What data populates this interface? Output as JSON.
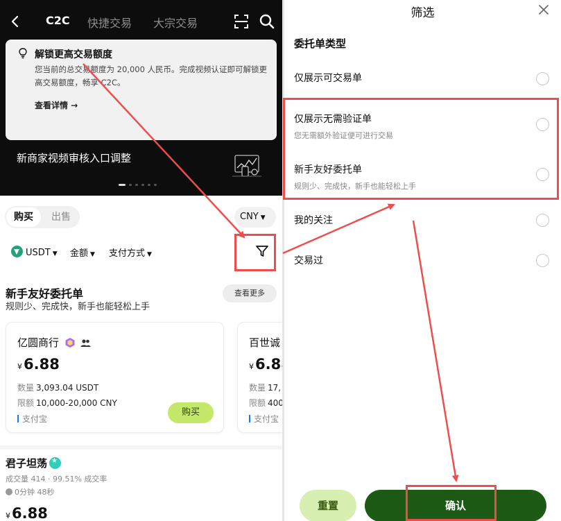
{
  "left": {
    "nav": {
      "tabs": [
        "C2C",
        "快捷交易",
        "大宗交易"
      ],
      "icons": [
        "back-icon",
        "scan-icon",
        "search-icon"
      ]
    },
    "promo": {
      "title": "解锁更高交易额度",
      "body": "您当前的总交易额度为 20,000 人民币。完成视频认证即可解锁更高交易额度，畅享 C2C。",
      "link": "查看详情 →"
    },
    "banner": {
      "text": "新商家视频审核入口调整"
    },
    "segment": {
      "buy": "购买",
      "sell": "出售"
    },
    "currency": "CNY",
    "filters": {
      "coin": "USDT",
      "amount": "金额",
      "payment": "支付方式"
    },
    "section": {
      "title": "新手友好委托单",
      "subtitle": "规则少、完成快，新手也能轻松上手",
      "see_more": "查看更多"
    },
    "cards": [
      {
        "merchant": "亿圆商行",
        "currency_symbol": "¥",
        "price": "6.88",
        "qty_label": "数量",
        "qty_value": "3,093.04 USDT",
        "limit_label": "限额",
        "limit_value": "10,000-20,000 CNY",
        "payment": "支付宝",
        "action": "购买"
      },
      {
        "merchant": "百世诚",
        "currency_symbol": "¥",
        "price": "6.88",
        "qty_label": "数量",
        "qty_value": "17,",
        "limit_label": "限额",
        "limit_value": "400",
        "payment": "支付宝"
      }
    ],
    "merchant2": {
      "name": "君子坦荡",
      "stats": "成交量 414 · 99.51% 成交率",
      "time": "0分钟 48秒",
      "currency_symbol": "¥",
      "price": "6.88"
    }
  },
  "right": {
    "title": "筛选",
    "section": "委托单类型",
    "options": [
      {
        "label": "仅展示可交易单",
        "sub": ""
      },
      {
        "label": "仅展示无需验证单",
        "sub": "您无需额外验证便可进行交易"
      },
      {
        "label": "新手友好委托单",
        "sub": "规则少、完成快，新手也能轻松上手"
      },
      {
        "label": "我的关注",
        "sub": ""
      },
      {
        "label": "交易过",
        "sub": ""
      }
    ],
    "reset": "重置",
    "confirm": "确认"
  },
  "colors": {
    "annotation_red": "#ee4d4d",
    "confirm_green": "#1c5a16",
    "reset_green": "#d7efb0",
    "buy_lime": "#c4e96a",
    "usdt_green": "#26a17b"
  }
}
